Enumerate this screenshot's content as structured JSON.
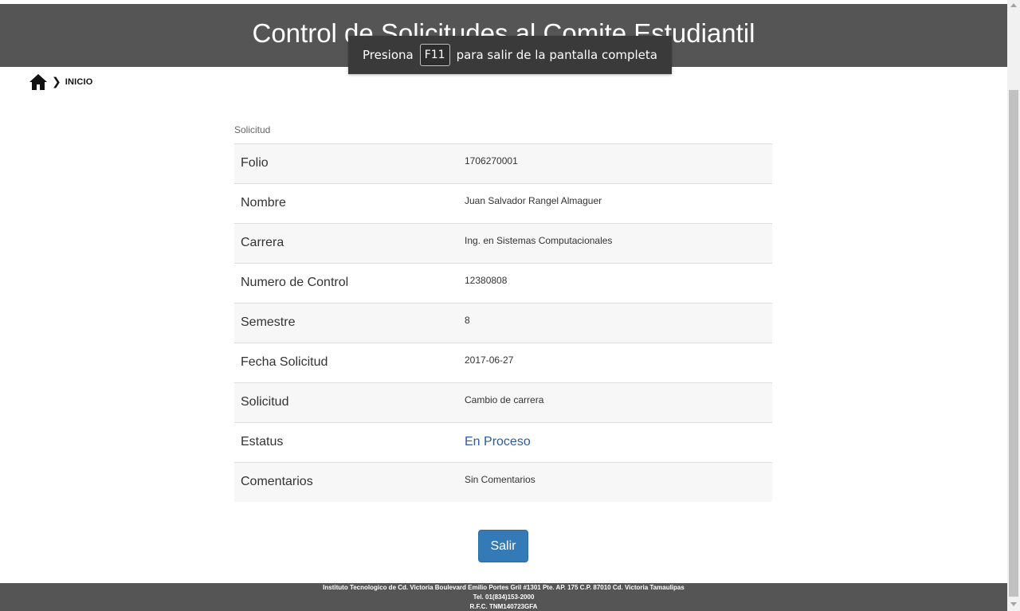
{
  "header": {
    "title": "Control de Solicitudes al Comite Estudiantil"
  },
  "fullscreen_notice": {
    "before": "Presiona",
    "key": "F11",
    "after": "para salir de la pantalla completa"
  },
  "breadcrumb": {
    "home_icon": "home-icon",
    "separator_icon": "chevron-right-icon",
    "label": "INICIO"
  },
  "panel": {
    "caption": "Solicitud",
    "rows": [
      {
        "label": "Folio",
        "value": "1706270001"
      },
      {
        "label": "Nombre",
        "value": "Juan Salvador Rangel Almaguer"
      },
      {
        "label": "Carrera",
        "value": "Ing. en Sistemas Computacionales"
      },
      {
        "label": "Numero de Control",
        "value": "12380808"
      },
      {
        "label": "Semestre",
        "value": "8"
      },
      {
        "label": "Fecha Solicitud",
        "value": "2017-06-27"
      },
      {
        "label": "Solicitud",
        "value": "Cambio de carrera"
      },
      {
        "label": "Estatus",
        "value": "En Proceso"
      },
      {
        "label": "Comentarios",
        "value": "Sin Comentarios"
      }
    ]
  },
  "actions": {
    "exit_label": "Salir"
  },
  "footer": {
    "line1": "Instituto Tecnologico de Cd. Victoria Boulevard Emilio Portes Gril #1301 Pte. AP. 175 C.P. 87010 Cd. Victoria Tamaulipas",
    "line2": "Tel. 01(834)153-2000",
    "line3": "R.F.C. TNM140723GFA"
  },
  "colors": {
    "header_bg": "#555555",
    "status_text": "#2c5c9a",
    "button_bg": "#337ab7"
  }
}
